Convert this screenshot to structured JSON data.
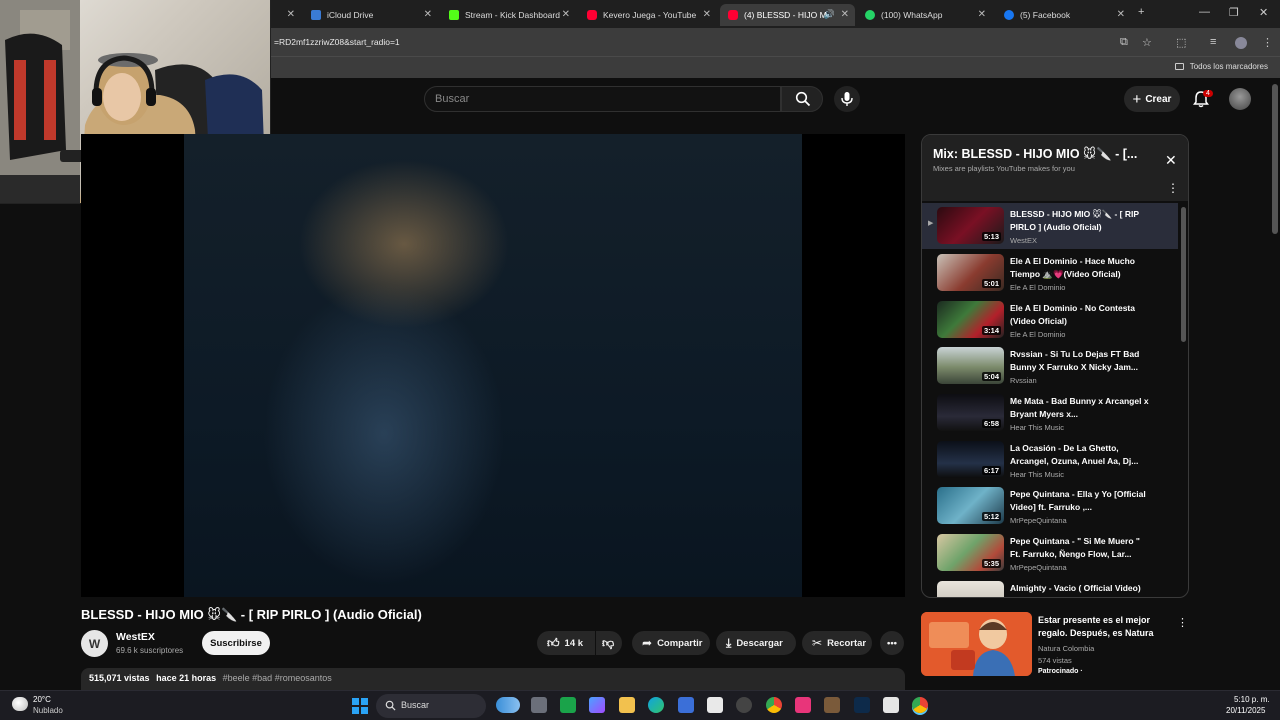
{
  "browser": {
    "tabs": [
      {
        "label": "iCloud Drive",
        "color": "#3a7bd5"
      },
      {
        "label": "Stream - Kick Dashboard",
        "color": "#53fc18"
      },
      {
        "label": "Kevero Juega - YouTube",
        "color": "#ff0033"
      },
      {
        "label": "(4) BLESSD - HIJO MI",
        "color": "#ff0033"
      },
      {
        "label": "(100) WhatsApp",
        "color": "#25d366"
      },
      {
        "label": "(5) Facebook",
        "color": "#1877f2"
      }
    ],
    "url": "=RD2mf1zzriwZ08&start_radio=1",
    "bookmarks_label": "Todos los marcadores"
  },
  "youtube": {
    "search_placeholder": "Buscar",
    "create_label": "Crear",
    "notifications_count": "4"
  },
  "video": {
    "title": "BLESSD - HIJO MIO 🐭🔪 - [ RIP PIRLO ] (Audio Oficial)",
    "channel": "WestEX",
    "subscribers": "69.6 k suscriptores",
    "subscribe_label": "Suscribirse",
    "likes": "14 k",
    "share_label": "Compartir",
    "download_label": "Descargar",
    "clip_label": "Recortar",
    "views": "515,071 vistas",
    "age": "hace 21 horas",
    "tags": "#beele #bad #romeosantos"
  },
  "playlist": {
    "title": "Mix: BLESSD - HIJO MIO 🐭🔪 - [...",
    "subtitle": "Mixes are playlists YouTube makes for you",
    "items": [
      {
        "title": "BLESSD - HIJO MIO 🐭🔪 - [ RIP PIRLO ] (Audio Oficial)",
        "channel": "WestEX",
        "duration": "5:13"
      },
      {
        "title": "Ele A El Dominio - Hace Mucho Tiempo ⛰️💗(Video Oficial)",
        "channel": "Ele A El Dominio",
        "duration": "5:01"
      },
      {
        "title": "Ele A El Dominio - No Contesta (Video Oficial)",
        "channel": "Ele A El Dominio",
        "duration": "3:14"
      },
      {
        "title": "Rvssian - Si Tu Lo Dejas FT Bad Bunny X Farruko X Nicky Jam...",
        "channel": "Rvssian",
        "duration": "5:04"
      },
      {
        "title": "Me Mata - Bad Bunny x Arcangel x Bryant Myers x...",
        "channel": "Hear This Music",
        "duration": "6:58"
      },
      {
        "title": "La Ocasión - De La Ghetto, Arcangel, Ozuna, Anuel Aa, Dj...",
        "channel": "Hear This Music",
        "duration": "6:17"
      },
      {
        "title": "Pepe Quintana - Ella y Yo [Official Video] ft. Farruko ,...",
        "channel": "MrPepeQuintana",
        "duration": "5:12"
      },
      {
        "title": "Pepe Quintana - \" Si Me Muero \" Ft. Farruko, Ñengo Flow, Lar...",
        "channel": "MrPepeQuintana",
        "duration": "5:35"
      },
      {
        "title": "Almighty - Vacio ( Official Video)",
        "channel": "",
        "duration": ""
      }
    ]
  },
  "ad": {
    "title": "Estar presente es el mejor regalo. Después, es Natura",
    "brand": "Natura Colombia",
    "views": "574 vistas",
    "tag": "Patrocinado ·"
  },
  "taskbar": {
    "temperature": "20°C",
    "weather": "Nublado",
    "search_label": "Buscar",
    "time": "5:10 p. m.",
    "date": "20/11/2025"
  }
}
